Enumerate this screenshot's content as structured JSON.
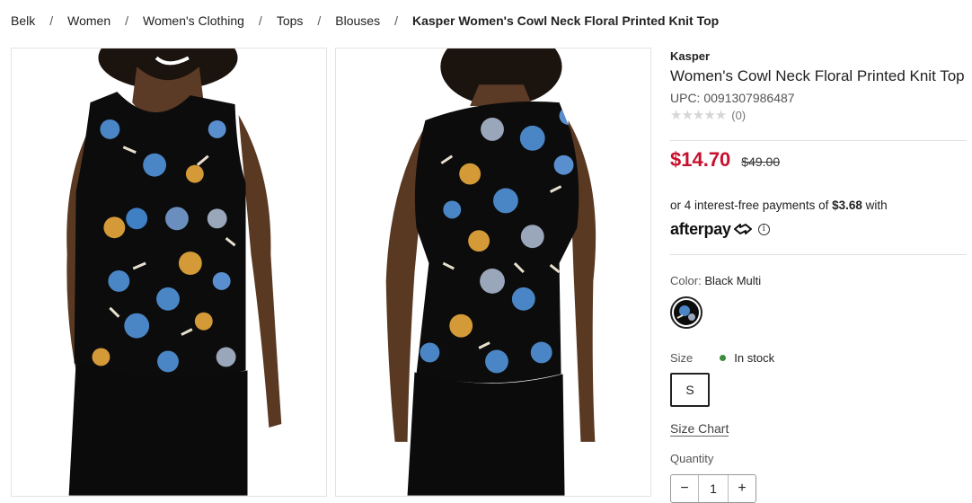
{
  "breadcrumb": {
    "items": [
      "Belk",
      "Women",
      "Women's Clothing",
      "Tops",
      "Blouses"
    ],
    "current": "Kasper Women's Cowl Neck Floral Printed Knit Top",
    "separator": "/"
  },
  "product": {
    "brand": "Kasper",
    "title": "Women's Cowl Neck Floral Printed Knit Top",
    "upc": "UPC: 0091307986487",
    "rating_count": "(0)",
    "rating_stars": 0,
    "sale_price": "$14.70",
    "original_price": "$49.00"
  },
  "afterpay": {
    "prefix": "or 4 interest-free payments of ",
    "amount": "$3.68",
    "suffix": " with",
    "logo_text": "afterpay",
    "info_icon": "i"
  },
  "color": {
    "label": "Color:",
    "value": "Black Multi"
  },
  "size": {
    "label": "Size",
    "stock": "In stock",
    "selected": "S",
    "chart_link": "Size Chart"
  },
  "quantity": {
    "label": "Quantity",
    "value": "1",
    "minus": "−",
    "plus": "+"
  },
  "icons": {
    "info": "info-circle-icon",
    "minus": "minus-icon",
    "plus": "plus-icon",
    "afterpay_arrow": "afterpay-arrow-icon"
  },
  "colors": {
    "sale": "#c8102e",
    "in_stock": "#3b8c3b",
    "top_print": "#0c0c0c",
    "flower_blue": "#4a86c6",
    "flower_orange": "#d49a38"
  }
}
